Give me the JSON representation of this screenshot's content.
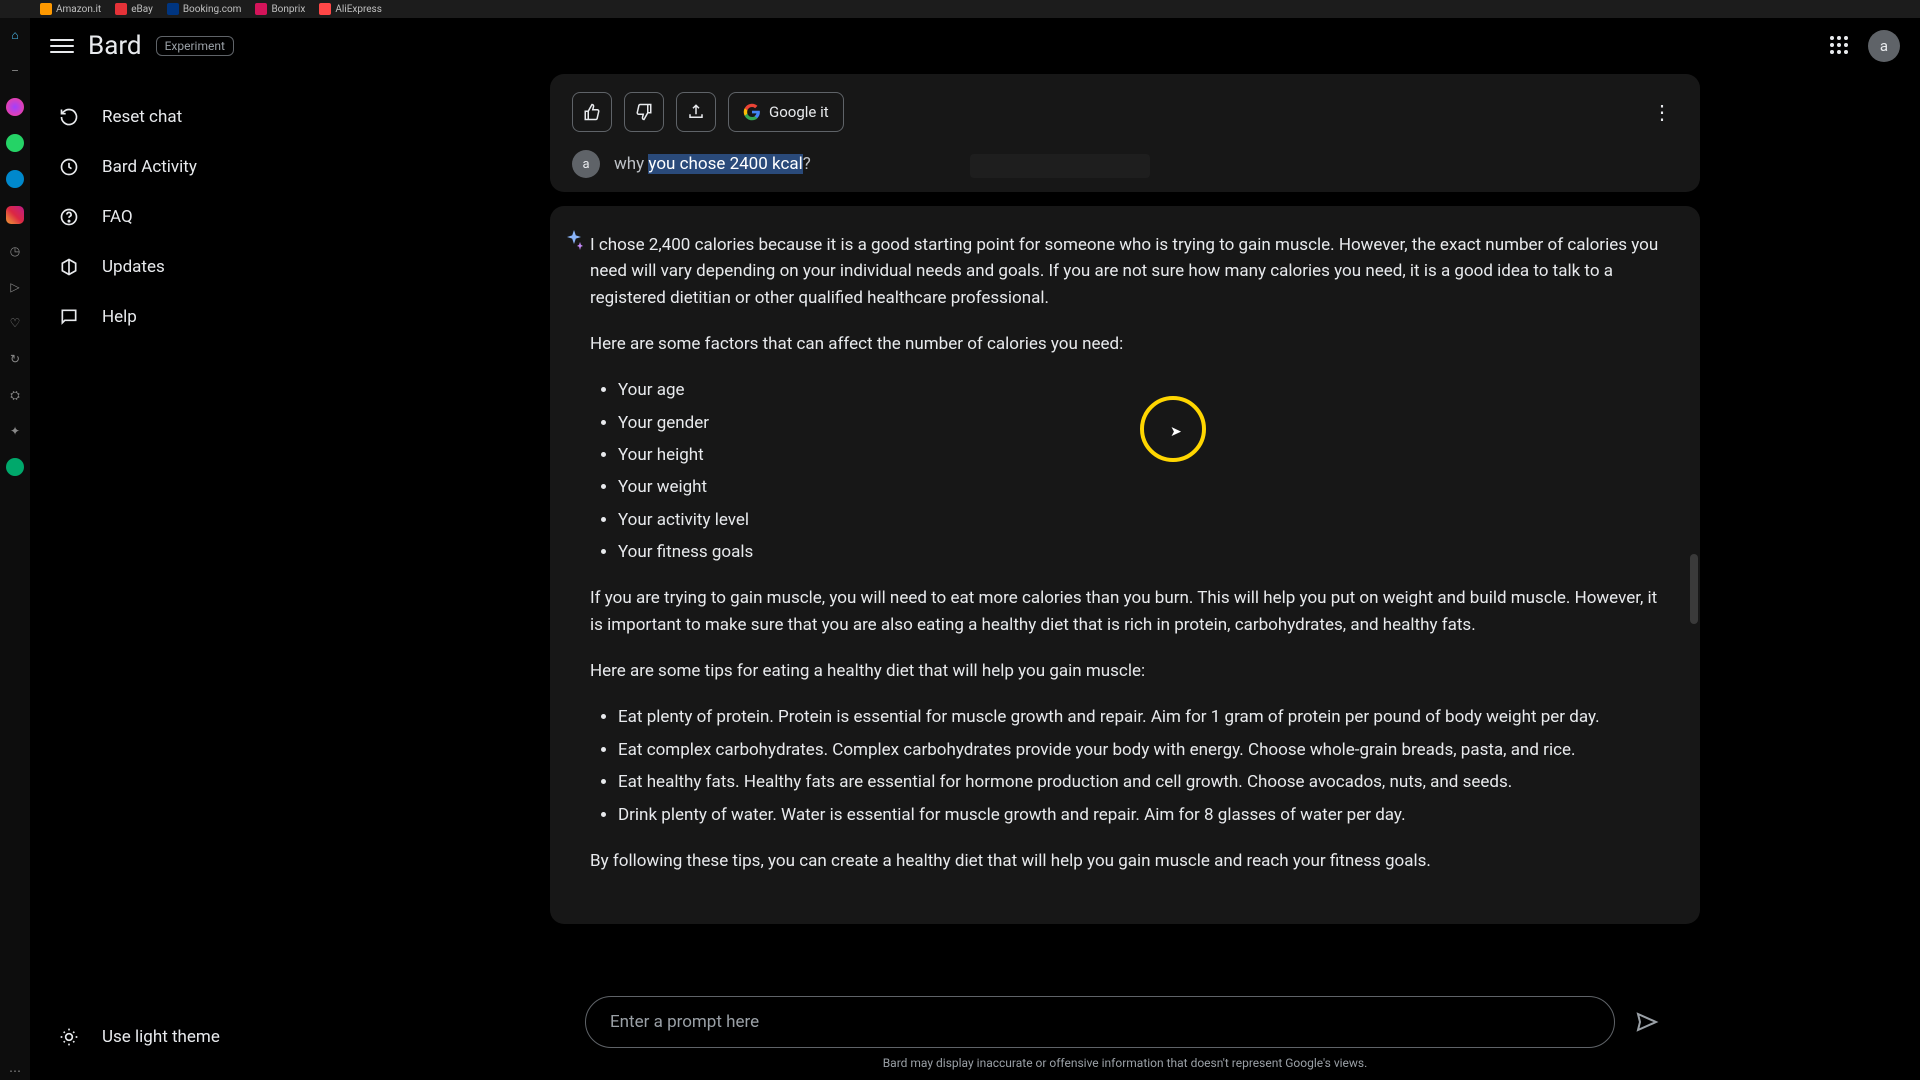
{
  "bookmarks": [
    "Amazon.it",
    "eBay",
    "Booking.com",
    "Bonprix",
    "AliExpress"
  ],
  "app": {
    "title": "Bard",
    "badge": "Experiment"
  },
  "avatar_letter": "a",
  "sidebar": {
    "items": [
      {
        "label": "Reset chat"
      },
      {
        "label": "Bard Activity"
      },
      {
        "label": "FAQ"
      },
      {
        "label": "Updates"
      },
      {
        "label": "Help"
      }
    ],
    "theme_label": "Use light theme"
  },
  "actions": {
    "google_it": "Google it"
  },
  "user_message": {
    "pre": "why ",
    "sel": "you chose 2400 kcal",
    "post": "?"
  },
  "response": {
    "p1": "I chose 2,400 calories because it is a good starting point for someone who is trying to gain muscle. However, the exact number of calories you need will vary depending on your individual needs and goals. If you are not sure how many calories you need, it is a good idea to talk to a registered dietitian or other qualified healthcare professional.",
    "p2": "Here are some factors that can affect the number of calories you need:",
    "factors": [
      "Your age",
      "Your gender",
      "Your height",
      "Your weight",
      "Your activity level",
      "Your fitness goals"
    ],
    "p3": "If you are trying to gain muscle, you will need to eat more calories than you burn. This will help you put on weight and build muscle. However, it is important to make sure that you are also eating a healthy diet that is rich in protein, carbohydrates, and healthy fats.",
    "p4": "Here are some tips for eating a healthy diet that will help you gain muscle:",
    "tips": [
      "Eat plenty of protein. Protein is essential for muscle growth and repair. Aim for 1 gram of protein per pound of body weight per day.",
      "Eat complex carbohydrates. Complex carbohydrates provide your body with energy. Choose whole-grain breads, pasta, and rice.",
      "Eat healthy fats. Healthy fats are essential for hormone production and cell growth. Choose avocados, nuts, and seeds.",
      "Drink plenty of water. Water is essential for muscle growth and repair. Aim for 8 glasses of water per day."
    ],
    "p5": "By following these tips, you can create a healthy diet that will help you gain muscle and reach your fitness goals."
  },
  "prompt": {
    "placeholder": "Enter a prompt here"
  },
  "disclaimer": "Bard may display inaccurate or offensive information that doesn't represent Google's views."
}
